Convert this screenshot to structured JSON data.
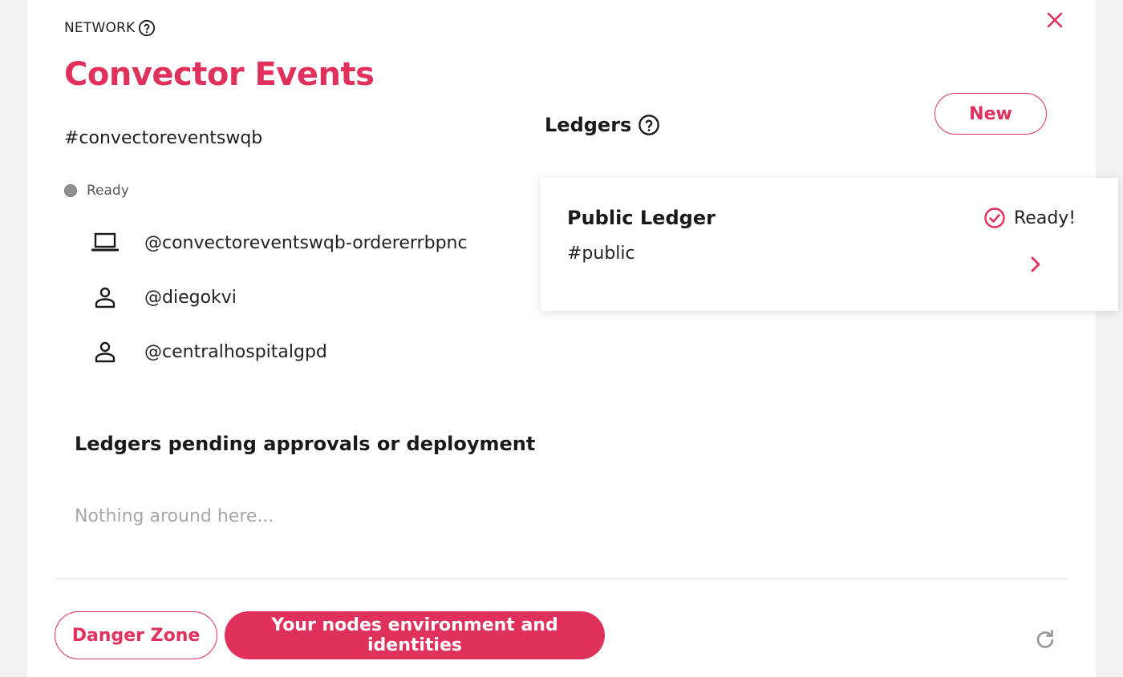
{
  "network": {
    "overline": "NETWORK",
    "title": "Convector Events",
    "handle": "#convectoreventswqb",
    "status": "Ready",
    "members": [
      {
        "icon": "laptop-icon",
        "name": "@convectoreventswqb-ordererrbpnc"
      },
      {
        "icon": "person-icon",
        "name": "@diegokvi"
      },
      {
        "icon": "person-icon",
        "name": "@centralhospitalgpd"
      }
    ]
  },
  "pending": {
    "title": "Ledgers pending approvals or deployment",
    "empty": "Nothing around here..."
  },
  "ledgers": {
    "title": "Ledgers",
    "new_label": "New",
    "items": [
      {
        "name": "Public Ledger",
        "tag": "#public",
        "status": "Ready!"
      }
    ]
  },
  "footer": {
    "danger_label": "Danger Zone",
    "env_label": "Your nodes environment and identities"
  },
  "colors": {
    "accent": "#e0305c",
    "status_dot": "#8f8f8f",
    "muted_text": "#a7a7a7"
  }
}
